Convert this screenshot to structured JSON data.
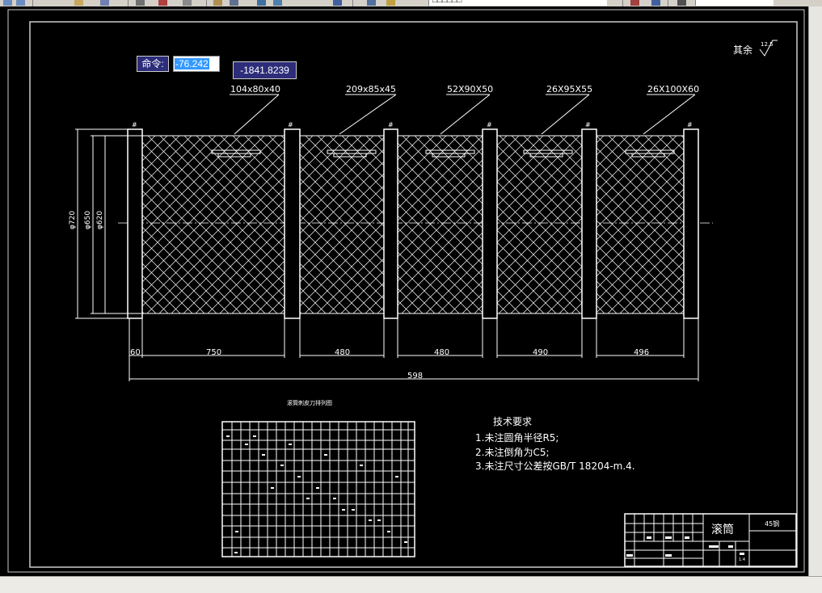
{
  "toolbar": {
    "layer_text": "□□□□□□",
    "icons": [
      "undo-icon",
      "redo-icon",
      "open-icon",
      "save-icon",
      "print-icon",
      "cut-icon",
      "copy-icon",
      "paste-icon",
      "match-icon",
      "layer-icon",
      "properties-icon",
      "help-icon"
    ]
  },
  "command": {
    "label": "命令:",
    "value": "-76.242",
    "coordinate": "-1841.8239"
  },
  "drawing": {
    "roughness_note": "其余",
    "roughness_value": "12.5",
    "section_labels": [
      "104x80x40",
      "209x85x45",
      "52X90X50",
      "26X95X55",
      "26X100X60"
    ],
    "section_mark": "#",
    "dia_labels": [
      "φ720",
      "φ650",
      "φ620"
    ],
    "dim_values": [
      "60",
      "750",
      "480",
      "480",
      "490",
      "496"
    ],
    "dim_total": "598",
    "table_caption": "滚筒刺皮刀排列图",
    "tech_title": "技术要求",
    "tech_items": [
      "1.未注圆角半径R5;",
      "2.未注倒角为C5;",
      "3.未注尺寸公差按GB/T 18204-m.4."
    ],
    "title_block": {
      "name": "滚筒",
      "material": "45钢",
      "scale_hint": "1:4"
    }
  }
}
